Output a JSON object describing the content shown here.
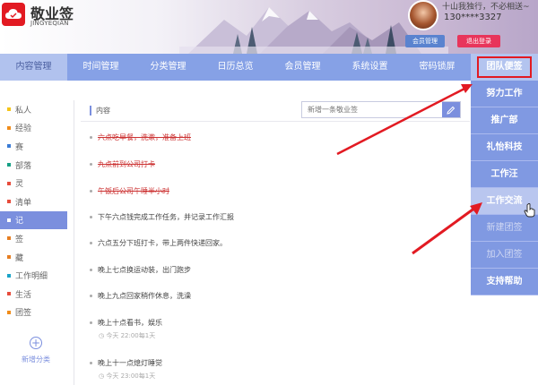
{
  "header": {
    "app_title": "敬业签",
    "app_subtitle": "JINGYEQIAN",
    "motto": "十山我独行，不必相送~",
    "phone": "130****3327",
    "member_button": "会员管理",
    "logout_button": "退出登录"
  },
  "nav": {
    "items": [
      "内容管理",
      "时间管理",
      "分类管理",
      "日历总览",
      "会员管理",
      "系统设置",
      "密码锁屏"
    ],
    "team_label": "团队便签"
  },
  "dropdown": {
    "items": [
      "努力工作",
      "推广部",
      "礼怡科技",
      "工作汪",
      "工作交流",
      "新建团签",
      "加入团签",
      "支持帮助"
    ]
  },
  "sidebar": {
    "items": [
      {
        "label": "私人",
        "color": "#f5c518"
      },
      {
        "label": "经验",
        "color": "#f08c1a"
      },
      {
        "label": "赛",
        "color": "#3a7bd5"
      },
      {
        "label": "部落",
        "color": "#16a085"
      },
      {
        "label": "灵",
        "color": "#e74c3c"
      },
      {
        "label": "清单",
        "color": "#e74c3c"
      },
      {
        "label": "记",
        "color": "#ffffff"
      },
      {
        "label": "签",
        "color": "#e67e22"
      },
      {
        "label": "藏",
        "color": "#e67e22"
      },
      {
        "label": "工作明细",
        "color": "#1aa3c8"
      },
      {
        "label": "生活",
        "color": "#e74c3c"
      },
      {
        "label": "团签",
        "color": "#f08c1a"
      }
    ],
    "add_label": "新增分类",
    "add_symbol": "+"
  },
  "main": {
    "title": "内容",
    "search_placeholder": "新增一条敬业签",
    "tasks": [
      {
        "text": "六点吃早餐，洗漱，准备上班",
        "done": true
      },
      {
        "text": "九点前到公司打卡",
        "done": true
      },
      {
        "text": "午饭后公司午睡半小时",
        "done": true
      },
      {
        "text": "下午六点钱完成工作任务，并记录工作汇报",
        "done": false
      },
      {
        "text": "六点五分下班打卡，带上两件快递回家。",
        "done": false
      },
      {
        "text": "晚上七点换运动装，出门跑步",
        "done": false
      },
      {
        "text": "晚上九点回家稍作休息，洗澡",
        "done": false
      },
      {
        "text": "晚上十点看书，娱乐",
        "done": false,
        "meta": "今天 22:00每1天"
      },
      {
        "text": "晚上十一点熄灯睡觉",
        "done": false,
        "meta": "今天 23:00每1天"
      }
    ]
  }
}
